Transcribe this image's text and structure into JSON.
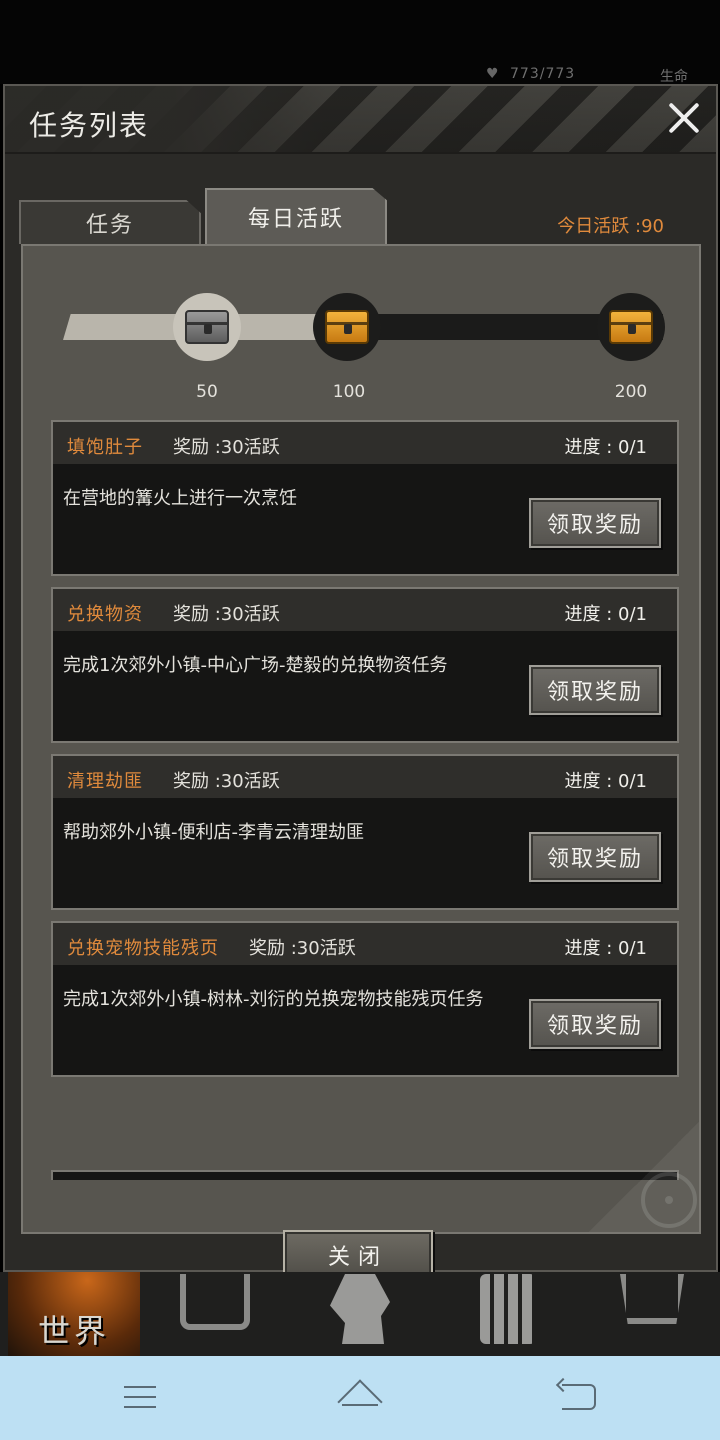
{
  "background_status": {
    "hp": "773/773",
    "right_label": "生命"
  },
  "panel": {
    "title": "任务列表"
  },
  "tabs": [
    {
      "label": "任务",
      "active": false
    },
    {
      "label": "每日活跃",
      "active": true
    }
  ],
  "activity_today": "今日活跃 :90",
  "progress": {
    "current": 90,
    "max": 200,
    "milestones": [
      {
        "value": 50,
        "label": "50",
        "chest": "silver",
        "claimed": true
      },
      {
        "value": 100,
        "label": "100",
        "chest": "gold",
        "claimed": false
      },
      {
        "value": 200,
        "label": "200",
        "chest": "gold",
        "claimed": false
      }
    ]
  },
  "quests": [
    {
      "name": "填饱肚子",
      "reward": "奖励 :30活跃",
      "progress": "进度 : 0/1",
      "desc": "在营地的篝火上进行一次烹饪",
      "button": "领取奖励"
    },
    {
      "name": "兑换物资",
      "reward": "奖励 :30活跃",
      "progress": "进度 : 0/1",
      "desc": "完成1次郊外小镇-中心广场-楚毅的兑换物资任务",
      "button": "领取奖励"
    },
    {
      "name": "清理劫匪",
      "reward": "奖励 :30活跃",
      "progress": "进度 : 0/1",
      "desc": "帮助郊外小镇-便利店-李青云清理劫匪",
      "button": "领取奖励"
    },
    {
      "name": "兑换宠物技能残页",
      "reward": "奖励 :30活跃",
      "progress": "进度 : 0/1",
      "desc": "完成1次郊外小镇-树林-刘衍的兑换宠物技能残页任务",
      "button": "领取奖励"
    }
  ],
  "close_button": "关闭",
  "game_nav": {
    "world_label": "世界"
  },
  "colors": {
    "accent": "#e08a3c",
    "panel_bg": "#2b2a27",
    "content_bg": "#57554f",
    "system_nav": "#bde0f3"
  }
}
